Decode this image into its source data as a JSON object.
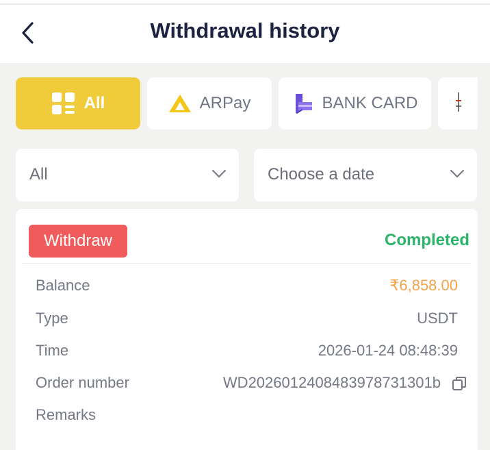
{
  "header": {
    "title": "Withdrawal history"
  },
  "tabs": [
    {
      "label": "All",
      "icon": "grid-list-icon",
      "active": true
    },
    {
      "label": "ARPay",
      "icon": "arpay-logo-icon",
      "active": false
    },
    {
      "label": "BANK CARD",
      "icon": "bank-card-icon",
      "active": false
    }
  ],
  "filters": {
    "type_value": "All",
    "date_placeholder": "Choose a date"
  },
  "record": {
    "badge": "Withdraw",
    "status": "Completed",
    "fields": [
      {
        "label": "Balance",
        "value": "₹6,858.00"
      },
      {
        "label": "Type",
        "value": "USDT"
      },
      {
        "label": "Time",
        "value": "2026-01-24 08:48:39"
      },
      {
        "label": "Order number",
        "value": "WD2026012408483978731301b"
      },
      {
        "label": "Remarks",
        "value": ""
      }
    ]
  },
  "colors": {
    "accent": "#f0cc3b",
    "badge": "#f05b5b",
    "status_completed": "#2cb46a",
    "amount": "#f0a34a",
    "title": "#1c2340"
  }
}
